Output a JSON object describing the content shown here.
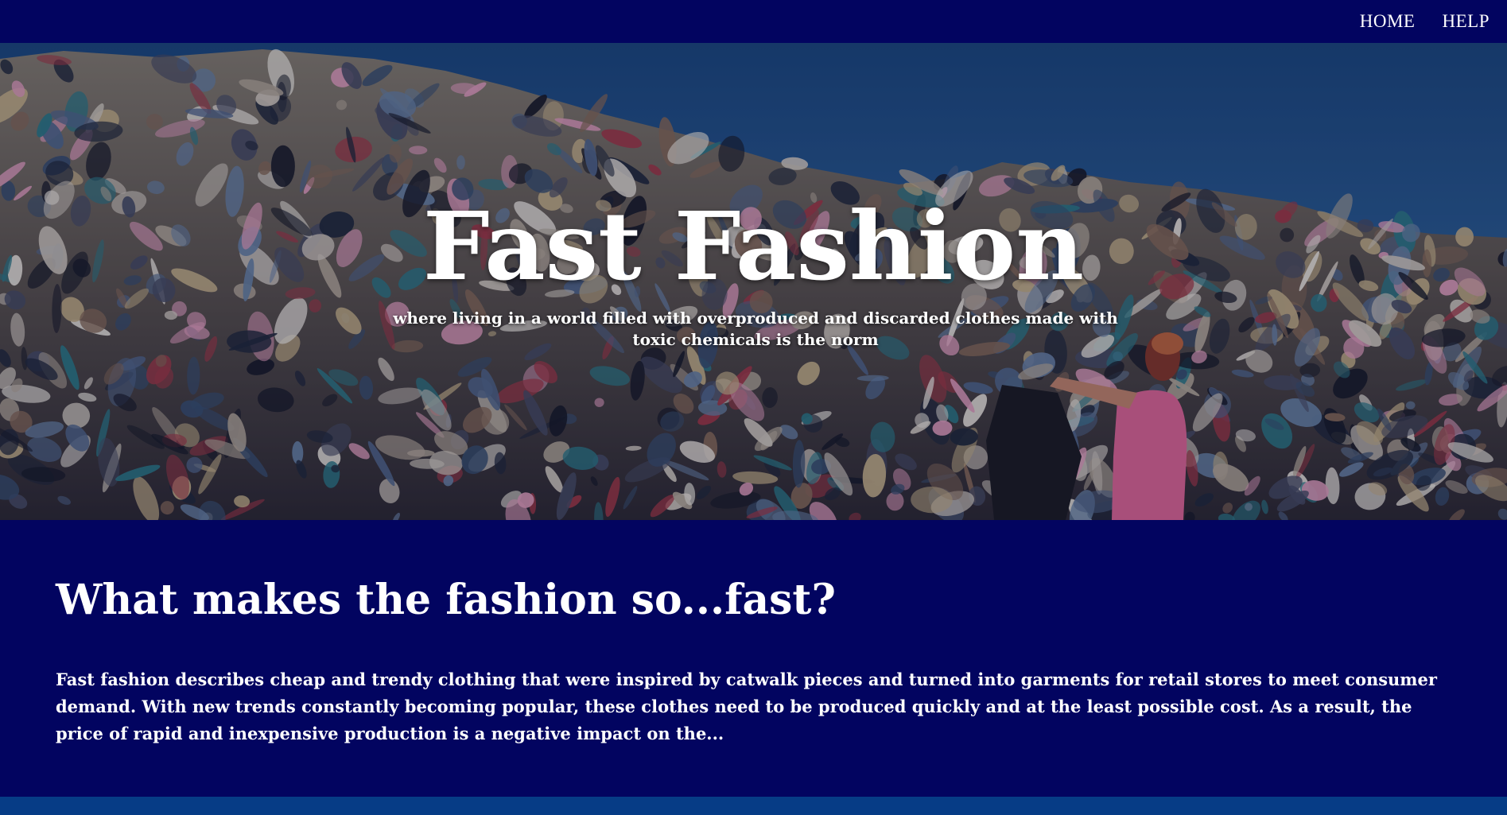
{
  "nav": {
    "items": [
      {
        "label": "HOME"
      },
      {
        "label": "HELP"
      }
    ]
  },
  "hero": {
    "title": "Fast Fashion",
    "subtitle": "where living in a world filled with overproduced and discarded clothes made with toxic chemicals is the norm"
  },
  "section": {
    "heading": "What makes the fashion so...fast?",
    "body": "Fast fashion describes cheap and trendy clothing that were inspired by catwalk pieces and turned into garments for retail stores to meet consumer demand. With new trends constantly becoming popular, these clothes need to be produced quickly and at the least possible cost. As a result, the price of rapid and inexpensive production is a negative impact on the..."
  },
  "colors": {
    "nav_background": "#020460",
    "content_background": "#020460",
    "bottom_strip": "#063c86",
    "text": "#ffffff"
  }
}
